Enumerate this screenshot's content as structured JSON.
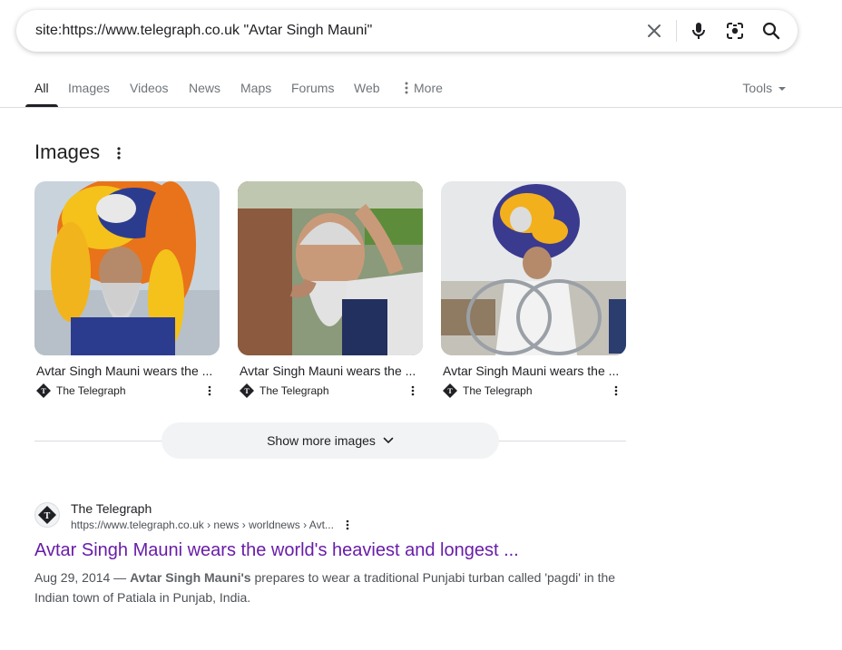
{
  "search": {
    "query": "site:https://www.telegraph.co.uk \"Avtar Singh Mauni\""
  },
  "tabs": [
    {
      "label": "All",
      "active": true
    },
    {
      "label": "Images"
    },
    {
      "label": "Videos"
    },
    {
      "label": "News"
    },
    {
      "label": "Maps"
    },
    {
      "label": "Forums"
    },
    {
      "label": "Web"
    },
    {
      "label": "More"
    }
  ],
  "tools_label": "Tools",
  "images_section": {
    "heading": "Images",
    "cards": [
      {
        "caption": "Avtar Singh Mauni wears the ...",
        "source": "The Telegraph"
      },
      {
        "caption": "Avtar Singh Mauni wears the ...",
        "source": "The Telegraph"
      },
      {
        "caption": "Avtar Singh Mauni wears the ...",
        "source": "The Telegraph"
      }
    ],
    "show_more_label": "Show more images"
  },
  "result": {
    "site_name": "The Telegraph",
    "url": "https://www.telegraph.co.uk › news › worldnews › Avt...",
    "title": "Avtar Singh Mauni wears the world's heaviest and longest ...",
    "date": "Aug 29, 2014",
    "separator": " — ",
    "snippet_bold": "Avtar Singh Mauni's",
    "snippet_rest": " prepares to wear a traditional Punjabi turban called 'pagdi' in the Indian town of Patiala in Punjab, India."
  },
  "colors": {
    "link_visited": "#681da8",
    "text": "#202124",
    "muted": "#70757a"
  }
}
